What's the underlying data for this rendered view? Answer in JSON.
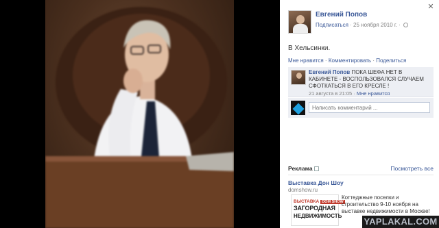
{
  "panel": {
    "owner_name": "Евгений Попов",
    "follow_label": "Подписаться",
    "post_date": "· 25 ноября 2010 г. ·",
    "caption": "В Хельсинки.",
    "actions": {
      "like": "Мне нравится",
      "sep1": " · ",
      "comment": "Комментировать",
      "sep2": " · ",
      "share": "Поделиться"
    },
    "comment": {
      "author": "Евгений Попов",
      "text": "ПОКА ШЕФА НЕТ В КАБИНЕТЕ - ВОСПОЛЬЗОВАЛСЯ СЛУЧАЕМ СФОТКАТЬСЯ В ЕГО КРЕСЛЕ !",
      "time": "21 августа в 21:05",
      "sep": " · ",
      "like": "Мне нравится"
    },
    "write_comment_placeholder": "Написать комментарий ...",
    "ads": {
      "title": "Реклама",
      "see_all": "Посмотреть все",
      "ad": {
        "name": "Выставка Дон Шоу",
        "domain": "domshow.ru",
        "image_line1": "ВЫСТАВКА",
        "image_line1_badge": "DOM SHOW",
        "image_line2": "ЗАГОРОДНАЯ",
        "image_line3": "НЕДВИЖИМОСТЬ",
        "description": "Коттеджные поселки и строительство 9-10 ноября на выставке недвижимости в Москве!"
      }
    }
  },
  "watermark": "YAPLAKAL.COM",
  "colors": {
    "link": "#3b5998",
    "muted": "#808080",
    "comment_bg": "#edeff4"
  }
}
